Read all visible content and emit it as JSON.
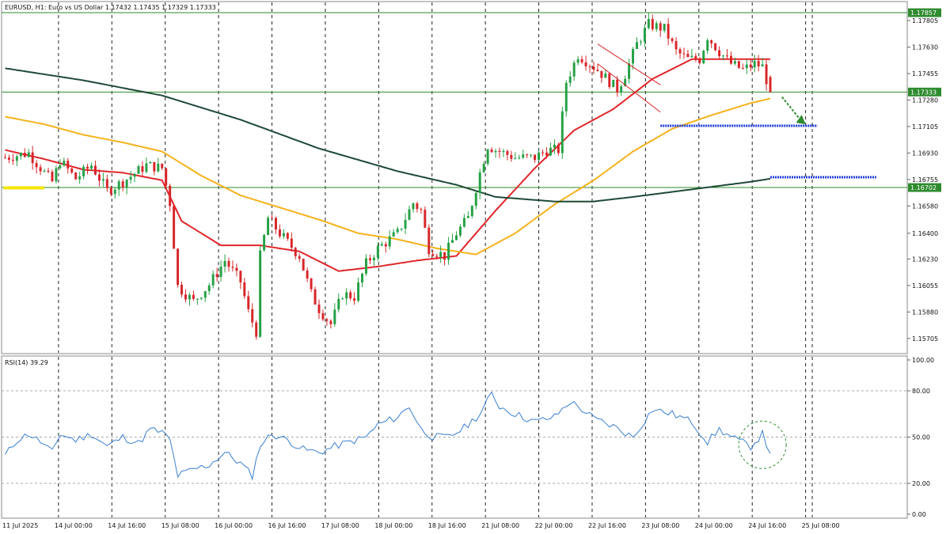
{
  "header": {
    "title": "EURUSD, H1:  Euro vs US Dollar  1.17432 1.17435 1.17329 1.17333"
  },
  "rsi_header": {
    "title": "RSI(14) 39.29"
  },
  "colors": {
    "bull": "#26a046",
    "bear": "#d8262a",
    "ema_fast": "#e0262a",
    "ema_mid": "#f5b21c",
    "ema_slow": "#1e4a36",
    "level_line": "#2e8b2e",
    "rsi_line": "#3a7fd0",
    "blue_dashed": "#1f3fd8",
    "highlight_yellow": "#f5e400",
    "arrow_green": "#2e8b2e"
  },
  "chart_data": [
    {
      "type": "candlestick",
      "title": "EURUSD, H1:  Euro vs US Dollar  1.17432 1.17435 1.17329 1.17333",
      "symbol": "EURUSD",
      "timeframe": "H1",
      "ohlc_last": {
        "open": 1.17432,
        "high": 1.17435,
        "low": 1.17329,
        "close": 1.17333
      },
      "ylim": [
        1.1561,
        1.1792
      ],
      "y_ticks": [
        "1.17805",
        "1.17630",
        "1.17455",
        "1.17280",
        "1.17105",
        "1.16930",
        "1.16755",
        "1.16580",
        "1.16400",
        "1.16230",
        "1.16055",
        "1.15880",
        "1.15705"
      ],
      "price_tags": [
        {
          "value": 1.17857,
          "label": "1.17857"
        },
        {
          "value": 1.17333,
          "label": "1.17333"
        },
        {
          "value": 1.16702,
          "label": "1.16702"
        }
      ],
      "x_ticks": [
        "11 Jul 2025",
        "14 Jul 00:00",
        "14 Jul 16:00",
        "15 Jul 08:00",
        "16 Jul 00:00",
        "16 Jul 16:00",
        "17 Jul 08:00",
        "18 Jul 00:00",
        "18 Jul 16:00",
        "21 Jul 08:00",
        "22 Jul 00:00",
        "22 Jul 16:00",
        "23 Jul 08:00",
        "24 Jul 00:00",
        "24 Jul 16:00",
        "25 Jul 08:00"
      ],
      "price_path": [
        [
          0,
          1.169
        ],
        [
          6,
          1.1693
        ],
        [
          10,
          1.168
        ],
        [
          12,
          1.1674
        ],
        [
          14,
          1.1688
        ],
        [
          18,
          1.1676
        ],
        [
          22,
          1.1685
        ],
        [
          26,
          1.1668
        ],
        [
          30,
          1.1674
        ],
        [
          36,
          1.1685
        ],
        [
          40,
          1.1683
        ],
        [
          42,
          1.166
        ],
        [
          44,
          1.1605
        ],
        [
          48,
          1.1595
        ],
        [
          52,
          1.1606
        ],
        [
          56,
          1.1622
        ],
        [
          60,
          1.1608
        ],
        [
          62,
          1.1588
        ],
        [
          64,
          1.1575
        ],
        [
          65,
          1.1625
        ],
        [
          67,
          1.165
        ],
        [
          70,
          1.164
        ],
        [
          75,
          1.1625
        ],
        [
          78,
          1.16
        ],
        [
          80,
          1.159
        ],
        [
          83,
          1.158
        ],
        [
          86,
          1.16
        ],
        [
          89,
          1.1598
        ],
        [
          92,
          1.162
        ],
        [
          95,
          1.163
        ],
        [
          100,
          1.164
        ],
        [
          104,
          1.166
        ],
        [
          106,
          1.1655
        ],
        [
          108,
          1.163
        ],
        [
          112,
          1.1625
        ],
        [
          115,
          1.164
        ],
        [
          118,
          1.165
        ],
        [
          121,
          1.168
        ],
        [
          123,
          1.1698
        ],
        [
          125,
          1.1695
        ],
        [
          130,
          1.169
        ],
        [
          135,
          1.169
        ],
        [
          138,
          1.1695
        ],
        [
          141,
          1.1695
        ],
        [
          143,
          1.174
        ],
        [
          146,
          1.1758
        ],
        [
          151,
          1.1748
        ],
        [
          156,
          1.1735
        ],
        [
          158,
          1.1745
        ],
        [
          161,
          1.1765
        ],
        [
          164,
          1.1778
        ],
        [
          168,
          1.1775
        ],
        [
          171,
          1.176
        ],
        [
          174,
          1.1755
        ],
        [
          177,
          1.1755
        ],
        [
          179,
          1.177
        ],
        [
          182,
          1.176
        ],
        [
          185,
          1.1752
        ],
        [
          188,
          1.1748
        ],
        [
          191,
          1.1752
        ],
        [
          193,
          1.175
        ],
        [
          195,
          1.1733
        ]
      ],
      "series": [
        {
          "values": [
            [
              0,
              1.1695
            ],
            [
              10,
              1.1689
            ],
            [
              20,
              1.1682
            ],
            [
              30,
              1.168
            ],
            [
              40,
              1.1675
            ],
            [
              45,
              1.1648
            ],
            [
              55,
              1.1632
            ],
            [
              65,
              1.1632
            ],
            [
              75,
              1.1628
            ],
            [
              85,
              1.1615
            ],
            [
              95,
              1.1618
            ],
            [
              105,
              1.1622
            ],
            [
              115,
              1.1625
            ],
            [
              125,
              1.1655
            ],
            [
              135,
              1.1683
            ],
            [
              145,
              1.1708
            ],
            [
              155,
              1.1722
            ],
            [
              165,
              1.1742
            ],
            [
              175,
              1.1755
            ],
            [
              185,
              1.1755
            ],
            [
              195,
              1.1755
            ]
          ]
        },
        {
          "values": [
            [
              0,
              1.1717
            ],
            [
              10,
              1.1712
            ],
            [
              20,
              1.1705
            ],
            [
              30,
              1.17
            ],
            [
              40,
              1.1694
            ],
            [
              50,
              1.1678
            ],
            [
              60,
              1.1665
            ],
            [
              70,
              1.1657
            ],
            [
              80,
              1.1649
            ],
            [
              90,
              1.164
            ],
            [
              100,
              1.1636
            ],
            [
              110,
              1.163
            ],
            [
              120,
              1.1626
            ],
            [
              130,
              1.164
            ],
            [
              140,
              1.1659
            ],
            [
              150,
              1.1675
            ],
            [
              160,
              1.1694
            ],
            [
              170,
              1.1709
            ],
            [
              180,
              1.1718
            ],
            [
              190,
              1.1726
            ],
            [
              195,
              1.1729
            ]
          ]
        },
        {
          "values": [
            [
              0,
              1.1749
            ],
            [
              20,
              1.1741
            ],
            [
              40,
              1.1731
            ],
            [
              60,
              1.1715
            ],
            [
              80,
              1.1696
            ],
            [
              100,
              1.1681
            ],
            [
              115,
              1.1672
            ],
            [
              125,
              1.1664
            ],
            [
              140,
              1.1661
            ],
            [
              150,
              1.1661
            ],
            [
              160,
              1.1664
            ],
            [
              175,
              1.1669
            ],
            [
              190,
              1.1674
            ],
            [
              195,
              1.1676
            ]
          ]
        }
      ],
      "annotations": [
        {
          "type": "descending-channel",
          "x": [
            151,
            167
          ],
          "y_top": [
            1.1765,
            1.1738
          ],
          "y_bottom": [
            1.1752,
            1.172
          ]
        },
        {
          "type": "horizontal-dashed-target",
          "x": [
            167,
            207
          ],
          "y": 1.1711
        },
        {
          "type": "horizontal-dashed-target",
          "x": [
            195,
            222
          ],
          "y": 1.1677
        },
        {
          "type": "arrow",
          "from": [
            198,
            1.173
          ],
          "to": [
            204,
            1.1712
          ]
        },
        {
          "type": "yellow-marker",
          "x": [
            0,
            10
          ],
          "y": 1.167
        }
      ]
    },
    {
      "type": "line",
      "title": "RSI(14) 39.29",
      "indicator": "RSI(14)",
      "last_value": 39.29,
      "ylim": [
        0,
        100
      ],
      "y_ticks": [
        "100.00",
        "80.00",
        "50.00",
        "20.00",
        "0.00"
      ],
      "levels": [
        80,
        50,
        20
      ],
      "values": [
        [
          0,
          38
        ],
        [
          3,
          48
        ],
        [
          6,
          52
        ],
        [
          9,
          47
        ],
        [
          12,
          40
        ],
        [
          14,
          52
        ],
        [
          18,
          48
        ],
        [
          22,
          52
        ],
        [
          26,
          44
        ],
        [
          30,
          50
        ],
        [
          34,
          46
        ],
        [
          37,
          55
        ],
        [
          40,
          53
        ],
        [
          42,
          48
        ],
        [
          44,
          25
        ],
        [
          48,
          29
        ],
        [
          52,
          32
        ],
        [
          56,
          40
        ],
        [
          60,
          33
        ],
        [
          63,
          25
        ],
        [
          65,
          45
        ],
        [
          68,
          52
        ],
        [
          72,
          48
        ],
        [
          76,
          42
        ],
        [
          80,
          40
        ],
        [
          84,
          44
        ],
        [
          88,
          47
        ],
        [
          92,
          50
        ],
        [
          95,
          58
        ],
        [
          100,
          63
        ],
        [
          103,
          70
        ],
        [
          106,
          55
        ],
        [
          109,
          50
        ],
        [
          113,
          50
        ],
        [
          117,
          56
        ],
        [
          121,
          65
        ],
        [
          124,
          78
        ],
        [
          126,
          70
        ],
        [
          130,
          65
        ],
        [
          135,
          60
        ],
        [
          140,
          63
        ],
        [
          144,
          73
        ],
        [
          147,
          68
        ],
        [
          150,
          62
        ],
        [
          155,
          57
        ],
        [
          160,
          50
        ],
        [
          165,
          68
        ],
        [
          170,
          65
        ],
        [
          175,
          60
        ],
        [
          179,
          47
        ],
        [
          182,
          55
        ],
        [
          185,
          50
        ],
        [
          190,
          44
        ],
        [
          193,
          52
        ],
        [
          195,
          39
        ]
      ],
      "annotations": [
        {
          "type": "circle-dashed",
          "center": [
            193,
            45
          ]
        }
      ]
    }
  ]
}
